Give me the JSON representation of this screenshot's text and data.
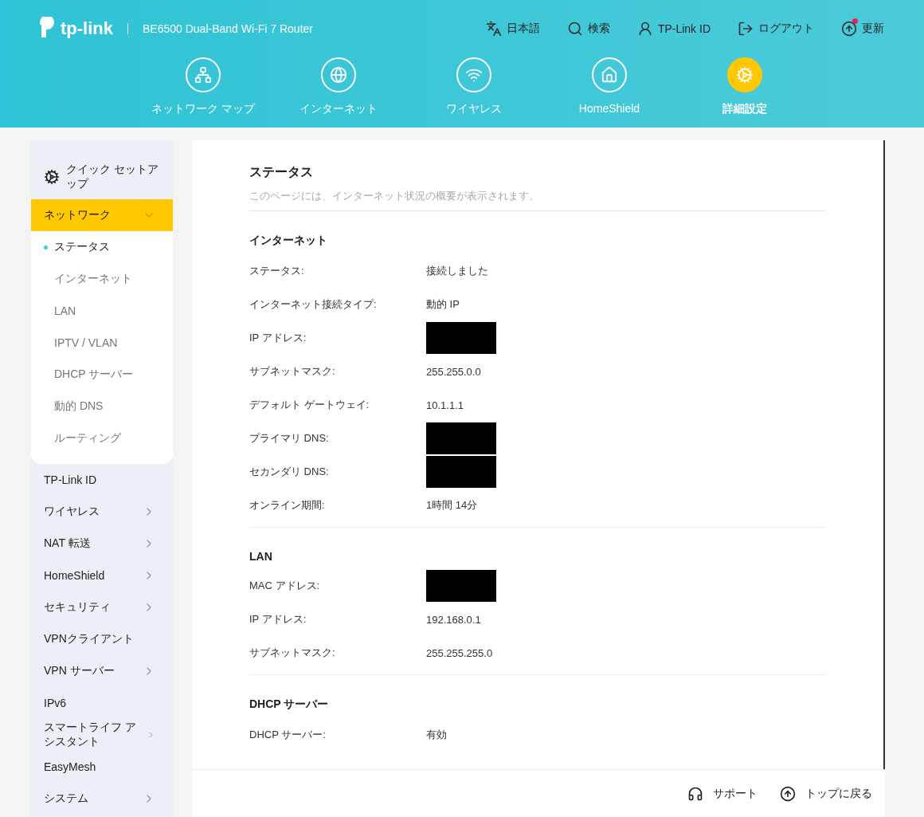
{
  "header": {
    "logo": "tp-link",
    "model": "BE6500 Dual-Band Wi-Fi 7 Router",
    "actions": [
      {
        "label": "日本語",
        "badge": false
      },
      {
        "label": "検索",
        "badge": false
      },
      {
        "label": "TP-Link ID",
        "badge": false
      },
      {
        "label": "ログアウト",
        "badge": false
      },
      {
        "label": "更新",
        "badge": true
      }
    ]
  },
  "nav": [
    {
      "label": "ネットワーク マップ",
      "selected": false
    },
    {
      "label": "インターネット",
      "selected": false
    },
    {
      "label": "ワイヤレス",
      "selected": false
    },
    {
      "label": "HomeShield",
      "selected": false
    },
    {
      "label": "詳細設定",
      "selected": true
    }
  ],
  "sidebar": {
    "quick_setup": "クイック セットアップ",
    "items": [
      {
        "label": "ネットワーク",
        "has_children": true,
        "expanded": true,
        "children": [
          {
            "label": "ステータス",
            "selected": true
          },
          {
            "label": "インターネット",
            "selected": false
          },
          {
            "label": "LAN",
            "selected": false
          },
          {
            "label": "IPTV / VLAN",
            "selected": false
          },
          {
            "label": "DHCP サーバー",
            "selected": false
          },
          {
            "label": "動的 DNS",
            "selected": false
          },
          {
            "label": "ルーティング",
            "selected": false
          }
        ]
      },
      {
        "label": "TP-Link ID",
        "has_children": false,
        "expanded": false
      },
      {
        "label": "ワイヤレス",
        "has_children": true,
        "expanded": false
      },
      {
        "label": "NAT 転送",
        "has_children": true,
        "expanded": false
      },
      {
        "label": "HomeShield",
        "has_children": true,
        "expanded": false
      },
      {
        "label": "セキュリティ",
        "has_children": true,
        "expanded": false
      },
      {
        "label": "VPNクライアント",
        "has_children": false,
        "expanded": false
      },
      {
        "label": "VPN サーバー",
        "has_children": true,
        "expanded": false
      },
      {
        "label": "IPv6",
        "has_children": false,
        "expanded": false
      },
      {
        "label": "スマートライフ アシスタント",
        "has_children": true,
        "expanded": false
      },
      {
        "label": "EasyMesh",
        "has_children": false,
        "expanded": false
      },
      {
        "label": "システム",
        "has_children": true,
        "expanded": false
      }
    ]
  },
  "content": {
    "title": "ステータス",
    "description": "このページには、インターネット状況の概要が表示されます。",
    "sections": [
      {
        "title": "インターネット",
        "rows": [
          {
            "label": "ステータス:",
            "kind": "text",
            "value": "接続しました"
          },
          {
            "label": "インターネット接続タイプ:",
            "kind": "text",
            "value": "動的 IP"
          },
          {
            "label": "IP アドレス:",
            "kind": "redacted"
          },
          {
            "label": "サブネットマスク:",
            "kind": "text",
            "value": "255.255.0.0"
          },
          {
            "label": "デフォルト ゲートウェイ:",
            "kind": "text",
            "value": "10.1.1.1"
          },
          {
            "label": "プライマリ DNS:",
            "kind": "redacted"
          },
          {
            "label": "セカンダリ DNS:",
            "kind": "redacted"
          },
          {
            "label": "オンライン期間:",
            "kind": "text",
            "value": "1時間 14分"
          }
        ]
      },
      {
        "title": "LAN",
        "rows": [
          {
            "label": "MAC アドレス:",
            "kind": "redacted"
          },
          {
            "label": "IP アドレス:",
            "kind": "text",
            "value": "192.168.0.1"
          },
          {
            "label": "サブネットマスク:",
            "kind": "text",
            "value": "255.255.255.0"
          }
        ]
      },
      {
        "title": "DHCP サーバー",
        "rows": [
          {
            "label": "DHCP サーバー:",
            "kind": "text",
            "value": "有効"
          }
        ]
      }
    ]
  },
  "footer": {
    "links": [
      {
        "label": "サポート"
      },
      {
        "label": "トップに戻る"
      }
    ]
  }
}
